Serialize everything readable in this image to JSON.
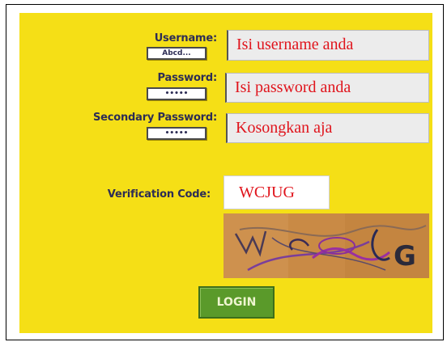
{
  "form": {
    "username_label": "Username:",
    "username_hint": "Abcd...",
    "username_value": "Isi username anda",
    "password_label": "Password:",
    "password_hint": "•••••",
    "password_value": "Isi password anda",
    "secondary_password_label": "Secondary Password:",
    "secondary_password_hint": "•••••",
    "secondary_password_value": "Kosongkan aja",
    "verification_label": "Verification Code:",
    "verification_value": "WCJUG",
    "login_label": "LOGIN"
  },
  "captcha": {
    "text": "WCJUG",
    "icon": "captcha-image"
  },
  "colors": {
    "panel": "#f5df16",
    "label": "#2d2d55",
    "field_text": "#e0141c",
    "login_button": "#5a9a2a"
  }
}
